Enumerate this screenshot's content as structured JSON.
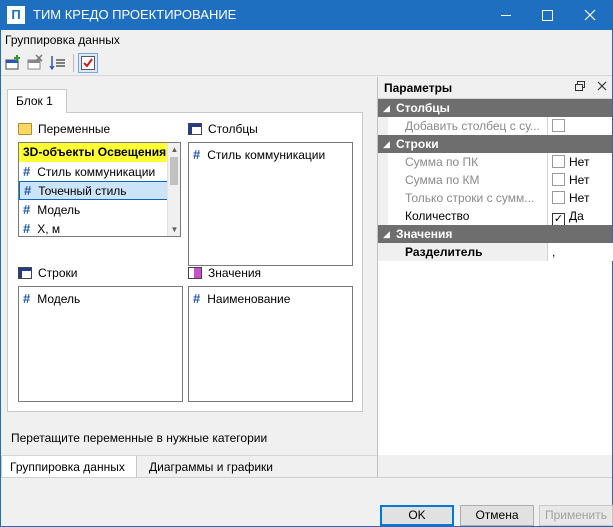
{
  "window": {
    "title": "ТИМ КРЕДО ПРОЕКТИРОВАНИЕ",
    "app_icon": "П"
  },
  "section_label": "Группировка данных",
  "tabs": {
    "block": "Блок 1"
  },
  "groups": {
    "variables": {
      "title": "Переменные",
      "items": [
        {
          "label": "3D-объекты Освещения",
          "hash": ""
        },
        {
          "label": "Стиль коммуникации",
          "hash": "#"
        },
        {
          "label": "Точечный стиль",
          "hash": "#"
        },
        {
          "label": "Модель",
          "hash": "#"
        },
        {
          "label": "X, м",
          "hash": "#"
        }
      ]
    },
    "columns": {
      "title": "Столбцы",
      "items": [
        {
          "label": "Стиль коммуникации",
          "hash": "#"
        }
      ]
    },
    "rows": {
      "title": "Строки",
      "items": [
        {
          "label": "Модель",
          "hash": "#"
        }
      ]
    },
    "values": {
      "title": "Значения",
      "items": [
        {
          "label": "Наименование",
          "hash": "#"
        }
      ]
    }
  },
  "hint": "Перетащите переменные в нужные категории",
  "params": {
    "title": "Параметры",
    "cat_columns": "Столбцы",
    "add_column": "Добавить столбец с су...",
    "cat_rows": "Строки",
    "sum_pk": "Сумма по ПК",
    "sum_km": "Сумма по КМ",
    "only_rows": "Только строки с сумм...",
    "count": "Количество",
    "cat_values": "Значения",
    "separator": "Разделитель",
    "separator_value": ",",
    "no": "Нет",
    "yes": "Да",
    "check": "✓"
  },
  "bottom_tabs": {
    "grouping": "Группировка данных",
    "charts": "Диаграммы и графики"
  },
  "buttons": {
    "ok": "OK",
    "cancel": "Отмена",
    "apply": "Применить"
  }
}
